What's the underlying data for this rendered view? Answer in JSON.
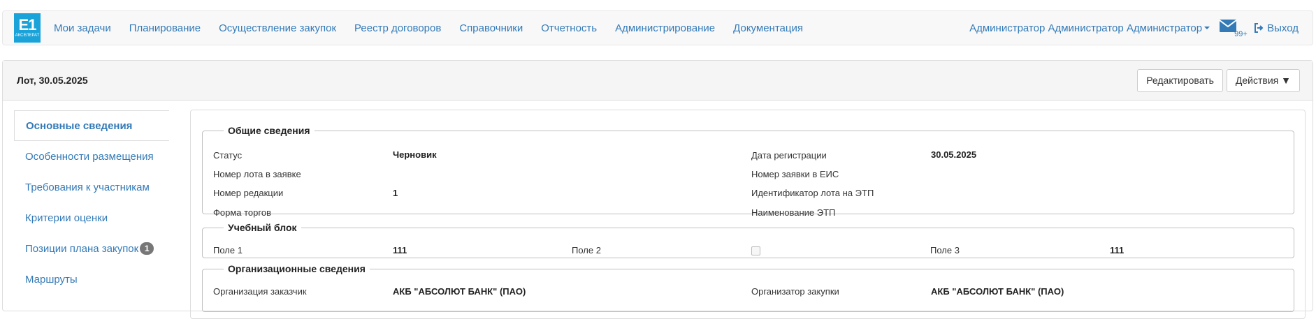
{
  "logo": {
    "text": "E1",
    "sub": "АКСЕЛЕРАТ"
  },
  "nav": {
    "items": [
      {
        "label": "Мои задачи"
      },
      {
        "label": "Планирование"
      },
      {
        "label": "Осуществление закупок"
      },
      {
        "label": "Реестр договоров"
      },
      {
        "label": "Справочники"
      },
      {
        "label": "Отчетность"
      },
      {
        "label": "Администрирование"
      },
      {
        "label": "Документация"
      }
    ],
    "user": "Администратор Администратор Администратор",
    "mail_badge": "99+",
    "logout": "Выход"
  },
  "panel": {
    "title": "Лот, 30.05.2025",
    "edit_button": "Редактировать",
    "actions_button": "Действия ▼"
  },
  "sidebar": {
    "items": [
      {
        "label": "Основные сведения",
        "active": true
      },
      {
        "label": "Особенности размещения"
      },
      {
        "label": "Требования к участникам"
      },
      {
        "label": "Критерии оценки"
      },
      {
        "label": "Позиции плана закупок",
        "count": "1"
      },
      {
        "label": "Маршруты"
      }
    ]
  },
  "general": {
    "legend": "Общие сведения",
    "status_label": "Статус",
    "status_value": "Черновик",
    "lot_number_label": "Номер лота в заявке",
    "lot_number_value": "",
    "edition_label": "Номер редакции",
    "edition_value": "1",
    "trade_form_label": "Форма торгов",
    "trade_form_value": "",
    "reg_date_label": "Дата регистрации",
    "reg_date_value": "30.05.2025",
    "eis_number_label": "Номер заявки в ЕИС",
    "eis_number_value": "",
    "etp_lot_id_label": "Идентификатор лота на ЭТП",
    "etp_lot_id_value": "",
    "etp_name_label": "Наименование ЭТП",
    "etp_name_value": ""
  },
  "training": {
    "legend": "Учебный блок",
    "field1_label": "Поле 1",
    "field1_value": "111",
    "field2_label": "Поле 2",
    "field2_checked": false,
    "field3_label": "Поле 3",
    "field3_value": "111"
  },
  "org": {
    "legend": "Организационные сведения",
    "customer_label": "Организация заказчик",
    "customer_value": "АКБ \"АБСОЛЮТ БАНК\" (ПАО)",
    "organizer_label": "Организатор закупки",
    "organizer_value": "АКБ \"АБСОЛЮТ БАНК\" (ПАО)"
  }
}
